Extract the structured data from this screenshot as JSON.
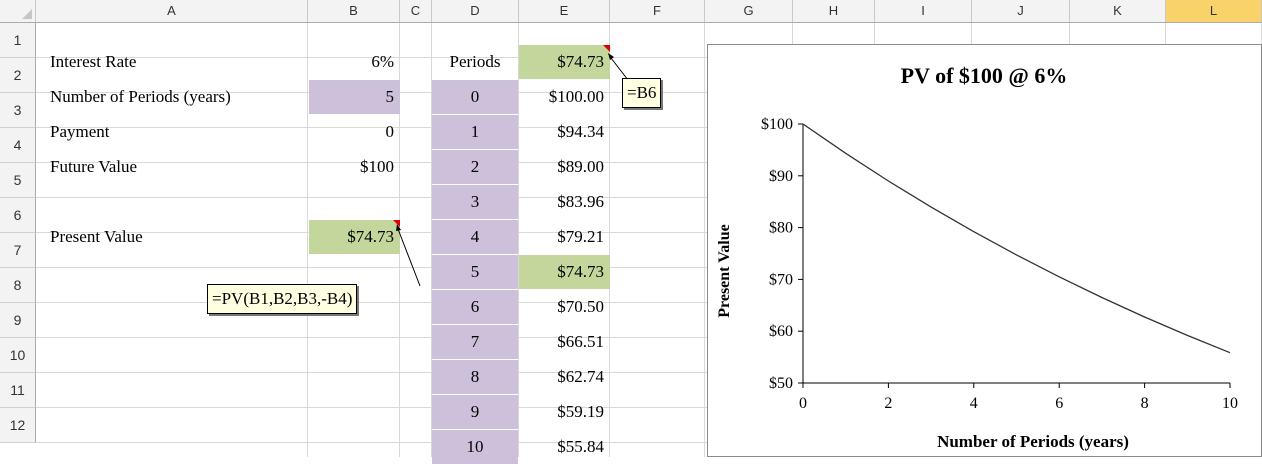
{
  "columns": [
    "A",
    "B",
    "C",
    "D",
    "E",
    "F",
    "G",
    "H",
    "I",
    "J",
    "K",
    "L"
  ],
  "selected_column": "L",
  "rows": [
    "1",
    "2",
    "3",
    "4",
    "5",
    "6",
    "7",
    "8",
    "9",
    "10",
    "11",
    "12"
  ],
  "inputs": {
    "interest_rate_label": "Interest Rate",
    "interest_rate_value": "6%",
    "periods_label": "Number of Periods (years)",
    "periods_value": "5",
    "payment_label": "Payment",
    "payment_value": "0",
    "future_value_label": "Future Value",
    "future_value_value": "$100",
    "present_value_label": "Present Value",
    "present_value_value": "$74.73"
  },
  "table": {
    "header_periods": "Periods",
    "header_value": "$74.73",
    "periods": [
      "0",
      "1",
      "2",
      "3",
      "4",
      "5",
      "6",
      "7",
      "8",
      "9",
      "10"
    ],
    "values": [
      "$100.00",
      "$94.34",
      "$89.00",
      "$83.96",
      "$79.21",
      "$74.73",
      "$70.50",
      "$66.51",
      "$62.74",
      "$59.19",
      "$55.84"
    ]
  },
  "comments": {
    "e1_formula": "=B6",
    "b6_formula": "=PV(B1,B2,B3,-B4)"
  },
  "colors": {
    "purple": "#ccc0da",
    "green": "#c3d69b",
    "selected_header": "#f9d26a"
  },
  "chart_data": {
    "type": "line",
    "title": "PV of $100 @ 6%",
    "xlabel": "Number of Periods (years)",
    "ylabel": "Present Value",
    "x": [
      0,
      1,
      2,
      3,
      4,
      5,
      6,
      7,
      8,
      9,
      10
    ],
    "series": [
      {
        "values": [
          100.0,
          94.34,
          89.0,
          83.96,
          79.21,
          74.73,
          70.5,
          66.51,
          62.74,
          59.19,
          55.84
        ]
      }
    ],
    "xticks": [
      "0",
      "2",
      "4",
      "6",
      "8",
      "10"
    ],
    "yticks": [
      "$50",
      "$60",
      "$70",
      "$80",
      "$90",
      "$100"
    ],
    "xlim": [
      0,
      10
    ],
    "ylim": [
      50,
      100
    ],
    "grid": false,
    "legend": "none"
  }
}
